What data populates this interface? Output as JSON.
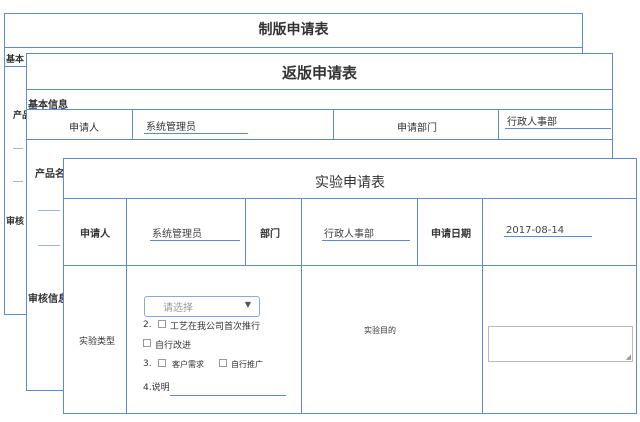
{
  "card1": {
    "title": "制版申请表",
    "section_basic": "基本",
    "product_label": "产品",
    "review_label": "审核"
  },
  "card2": {
    "title": "返版申请表",
    "section_basic": "基本信息",
    "applicant_label": "申请人",
    "applicant_value": "系统管理员",
    "dept_label": "申请部门",
    "dept_value": "行政人事部",
    "product_label": "产品名",
    "review_label": "审核信息"
  },
  "card3": {
    "title": "实验申请表",
    "applicant_label": "申请人",
    "applicant_value": "系统管理员",
    "dept_label": "部门",
    "dept_value": "行政人事部",
    "date_label": "申请日期",
    "date_value": "2017-08-14",
    "type_label": "实验类型",
    "select_placeholder": "请选择",
    "opt2_num": "2.",
    "opt2a": "工艺在我公司首次推行",
    "opt2b": "自行改进",
    "opt3_num": "3.",
    "opt3a": "客户需求",
    "opt3b": "自行推广",
    "opt4": "4.说明",
    "purpose_label": "实验目的"
  }
}
